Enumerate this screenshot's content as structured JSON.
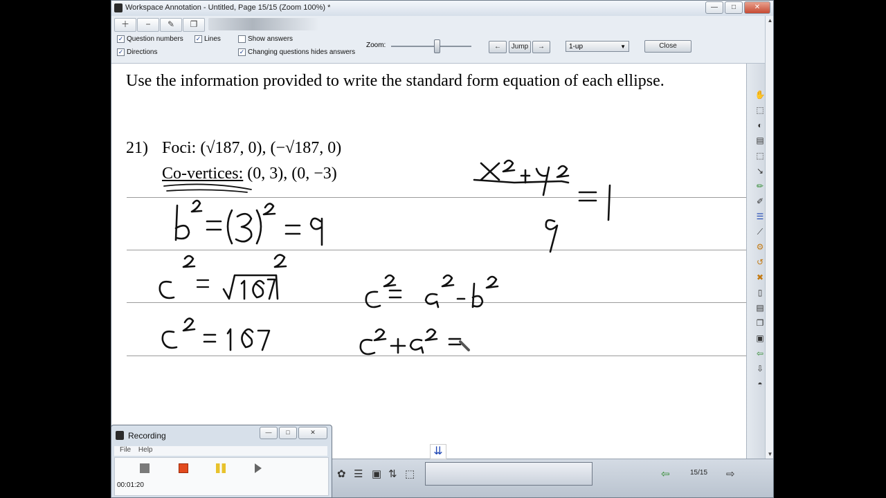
{
  "window": {
    "title": "Workspace Annotation - Untitled, Page 15/15  (Zoom 100%) *",
    "min_label": "—",
    "max_label": "□",
    "close_label": "✕"
  },
  "toolbar": {
    "icons": [
      "plus-icon",
      "minus-icon",
      "edit-icon",
      "copy-icon"
    ],
    "checkboxes": {
      "question_numbers": "Question numbers",
      "lines": "Lines",
      "show_answers": "Show answers",
      "directions": "Directions",
      "changing_hides": "Changing questions hides answers"
    },
    "checked_mark": "✓",
    "zoom_label": "Zoom:",
    "back_label": "←",
    "jump_label": "Jump",
    "forward_label": "→",
    "layout_select": "1-up",
    "close_label": "Close"
  },
  "document": {
    "instruction": "Use the information provided to write the standard form equation of each ellipse.",
    "question_number": "21)",
    "foci_label": "Foci:",
    "foci_value": "(√187, 0), (−√187, 0)",
    "covertices_label": "Co-vertices:",
    "covertices_value": "(0, 3), (0, −3)",
    "handwriting": {
      "b_sq": "b² = (3)² = 9",
      "c_sq_sqrt": "c² = √187²",
      "c_sq": "c² = 187",
      "relation": "c² = a² − b²",
      "partial": "c² + a² =",
      "equation": "x²/… + y²/9 = 1"
    }
  },
  "bottombar": {
    "page_indicator": "15/15",
    "down_arrows": "⇊"
  },
  "recording": {
    "title": "Recording",
    "menu_file": "File",
    "menu_help": "Help",
    "time": "00:01:20",
    "min_label": "—",
    "max_label": "□",
    "close_label": "✕"
  }
}
